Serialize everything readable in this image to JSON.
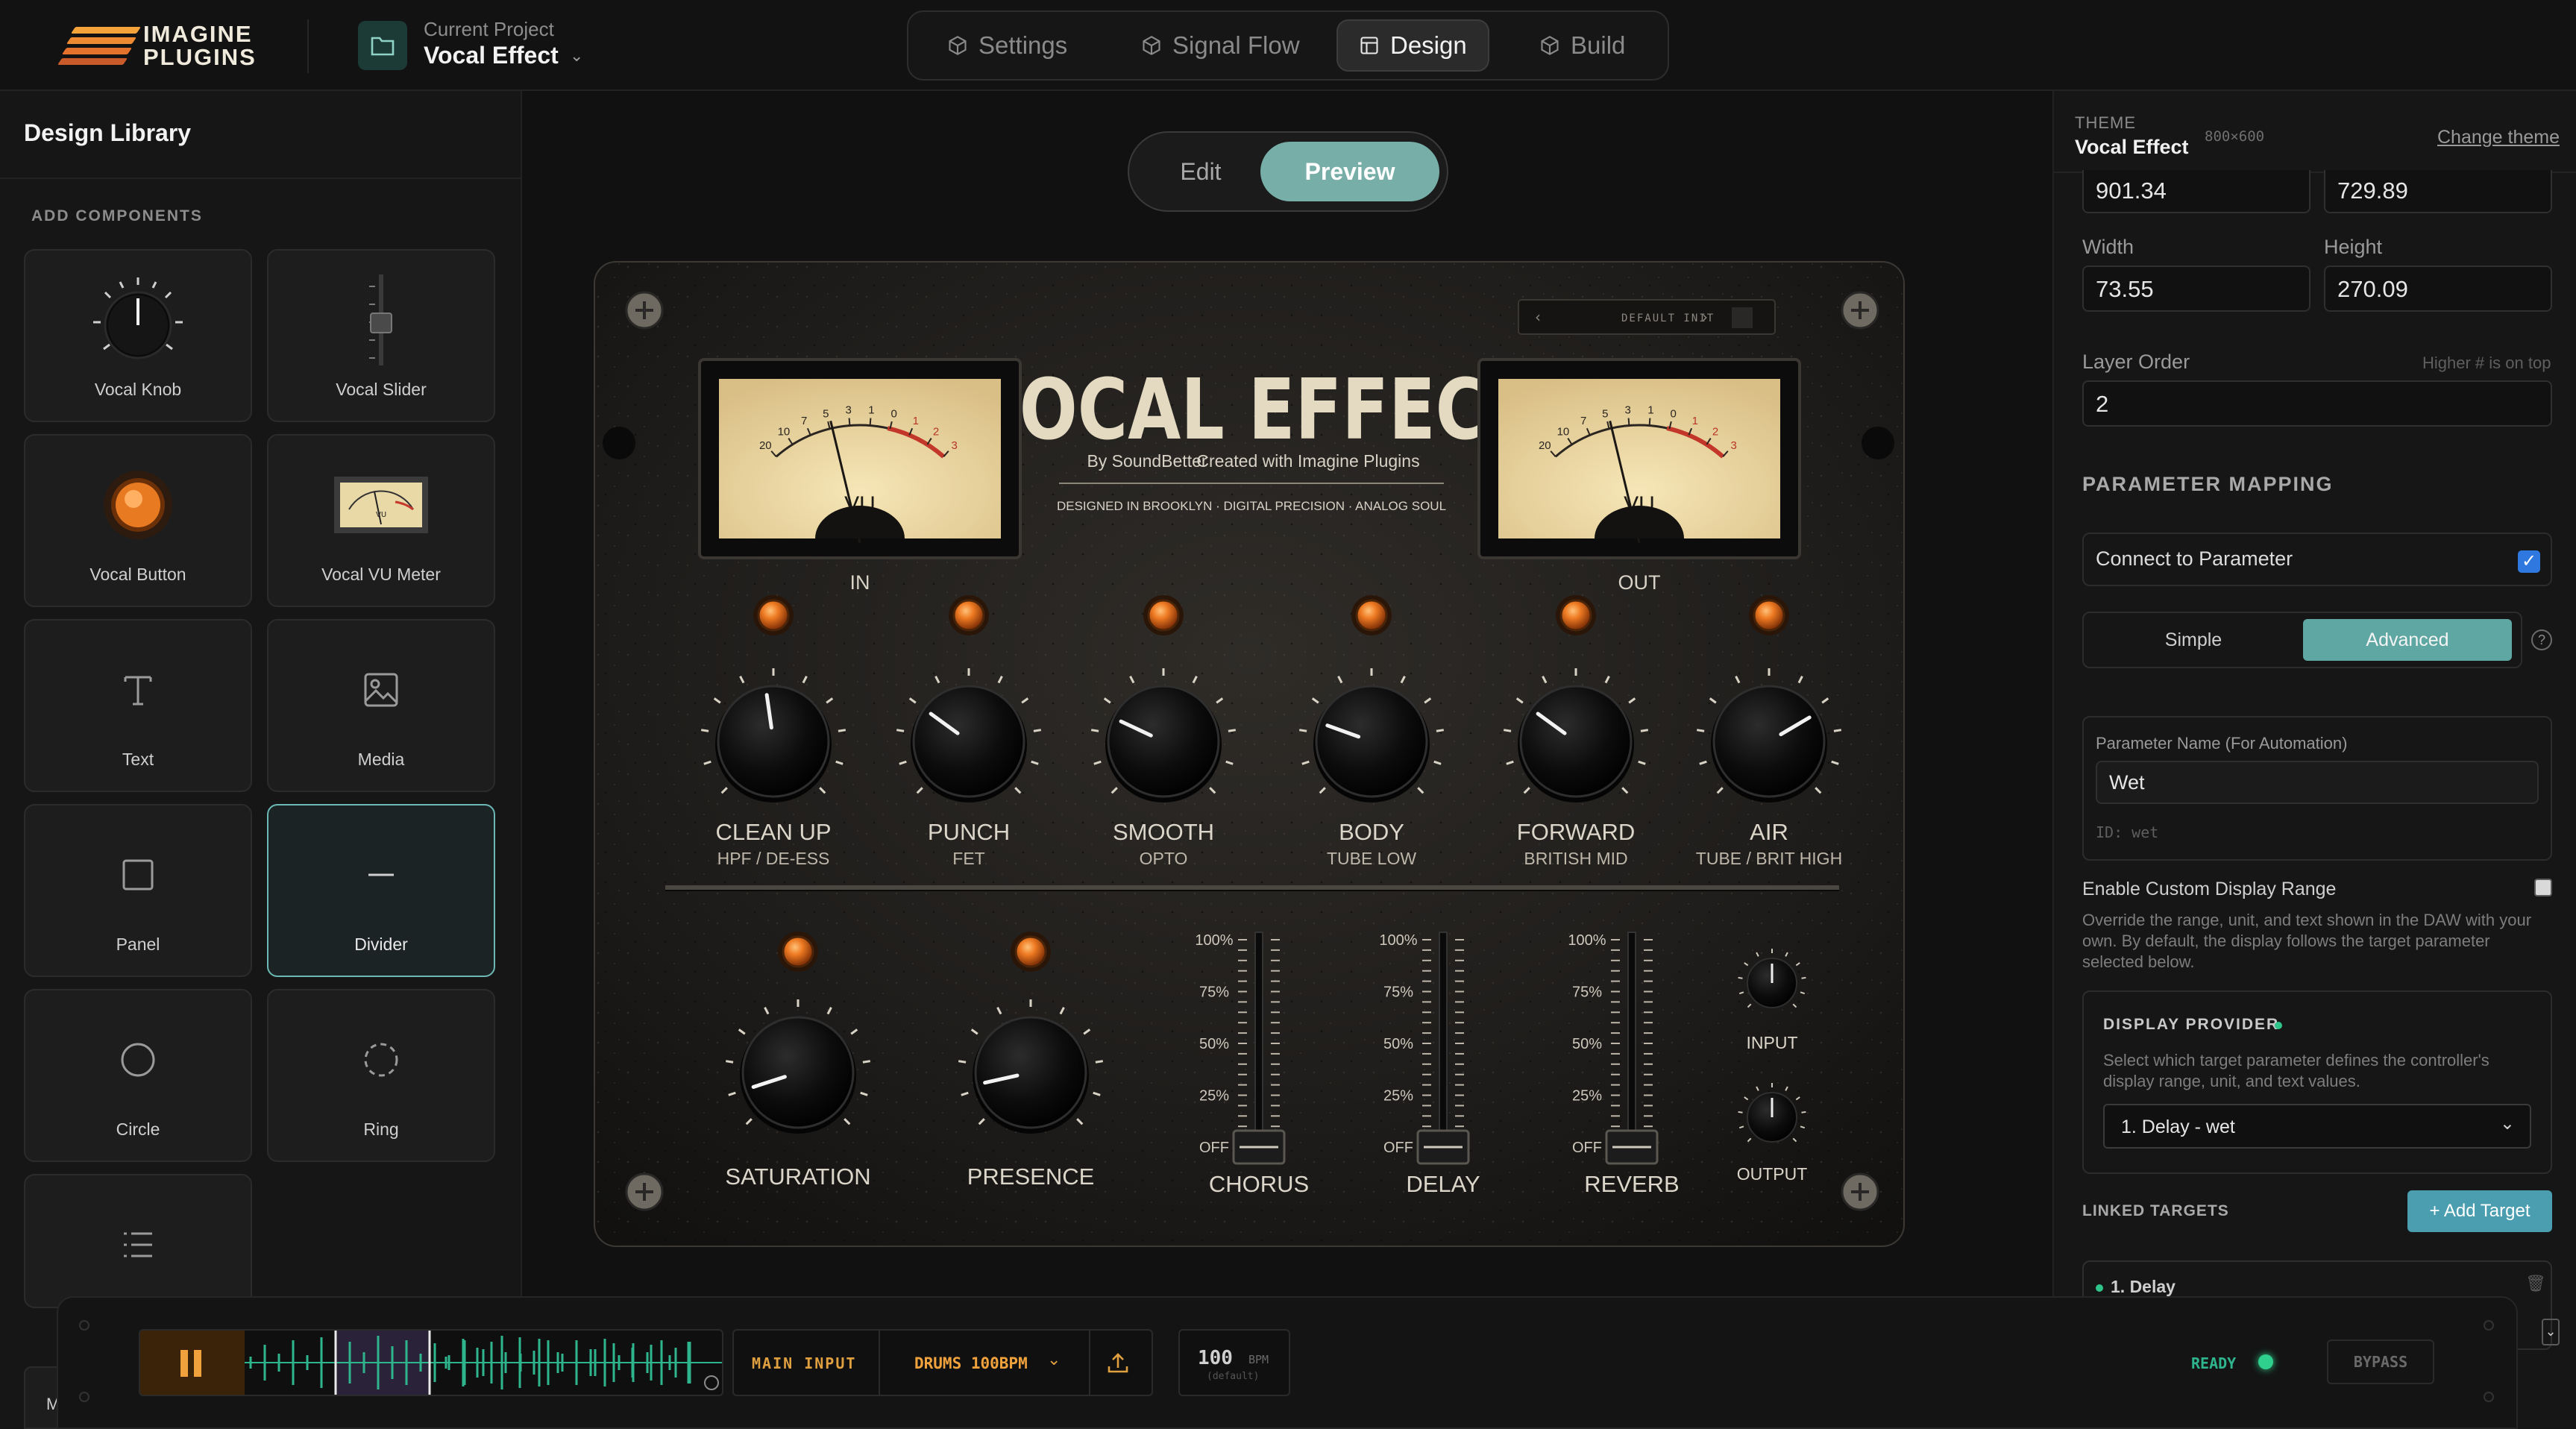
{
  "brand": {
    "name_line1": "IMAGINE",
    "name_line2": "PLUGINS"
  },
  "project": {
    "label": "Current Project",
    "name": "Vocal Effect"
  },
  "nav_tabs": [
    {
      "label": "Settings",
      "icon": "cube-icon",
      "active": false
    },
    {
      "label": "Signal Flow",
      "icon": "cube-icon",
      "active": false
    },
    {
      "label": "Design",
      "icon": "layout-icon",
      "active": true
    },
    {
      "label": "Build",
      "icon": "cube-icon",
      "active": false
    }
  ],
  "library": {
    "title": "Design Library",
    "section": "ADD COMPONENTS",
    "items": [
      {
        "label": "Vocal Knob",
        "icon": "knob-icon"
      },
      {
        "label": "Vocal Slider",
        "icon": "slider-icon"
      },
      {
        "label": "Vocal Button",
        "icon": "orange-button-icon"
      },
      {
        "label": "Vocal VU Meter",
        "icon": "vu-meter-icon"
      },
      {
        "label": "Text",
        "icon": "text-icon"
      },
      {
        "label": "Media",
        "icon": "image-icon"
      },
      {
        "label": "Panel",
        "icon": "square-icon"
      },
      {
        "label": "Divider",
        "icon": "divider-icon"
      },
      {
        "label": "Circle",
        "icon": "circle-icon"
      },
      {
        "label": "Ring",
        "icon": "dashed-circle-icon"
      },
      {
        "label": "",
        "icon": "list-icon"
      }
    ],
    "truncated_item": "M"
  },
  "mode_toggle": {
    "edit": "Edit",
    "preview": "Preview",
    "active": "Preview"
  },
  "plugin": {
    "title": "VOCAL EFFECT",
    "byline": "By SoundBetter",
    "created": "Created with Imagine Plugins",
    "tagline": "DESIGNED IN BROOKLYN · DIGITAL PRECISION · ANALOG SOUL",
    "preset": "DEFAULT INIT",
    "meters": [
      {
        "label": "IN",
        "scale": [
          "20",
          "10",
          "7",
          "5",
          "3",
          "1",
          "0",
          "1",
          "2",
          "3"
        ],
        "unit": "VU"
      },
      {
        "label": "OUT",
        "scale": [
          "20",
          "10",
          "7",
          "5",
          "3",
          "1",
          "0",
          "1",
          "2",
          "3"
        ],
        "unit": "VU"
      }
    ],
    "knobs_top": [
      {
        "name": "CLEAN UP",
        "sub": "HPF / DE-ESS",
        "value": 0.47
      },
      {
        "name": "PUNCH",
        "sub": "FET",
        "value": 0.3
      },
      {
        "name": "SMOOTH",
        "sub": "OPTO",
        "value": 0.26
      },
      {
        "name": "BODY",
        "sub": "TUBE LOW",
        "value": 0.24
      },
      {
        "name": "FORWARD",
        "sub": "BRITISH MID",
        "value": 0.3
      },
      {
        "name": "AIR",
        "sub": "TUBE / BRIT HIGH",
        "value": 0.72
      }
    ],
    "knobs_bottom": [
      {
        "name": "SATURATION",
        "value": 0.1
      },
      {
        "name": "PRESENCE",
        "value": 0.12
      }
    ],
    "faders": [
      {
        "name": "CHORUS",
        "value": 0.0
      },
      {
        "name": "DELAY",
        "value": 0.0
      },
      {
        "name": "REVERB",
        "value": 0.0
      }
    ],
    "fader_scale": [
      "100%",
      "75%",
      "50%",
      "25%",
      "OFF"
    ],
    "small_knobs": [
      {
        "name": "INPUT",
        "value": 0.5
      },
      {
        "name": "OUTPUT",
        "value": 0.5
      }
    ]
  },
  "inspector": {
    "theme_label": "THEME",
    "theme_name": "Vocal Effect",
    "theme_size": "800×600",
    "change_theme": "Change theme",
    "x_value": "901.34",
    "y_value": "729.89",
    "width_label": "Width",
    "width_value": "73.55",
    "height_label": "Height",
    "height_value": "270.09",
    "layer_label": "Layer Order",
    "layer_hint": "Higher # is on top",
    "layer_value": "2",
    "param_section": "PARAMETER MAPPING",
    "connect_label": "Connect to Parameter",
    "connect_checked": true,
    "mode_simple": "Simple",
    "mode_advanced": "Advanced",
    "param_name_label": "Parameter Name (For Automation)",
    "param_name_value": "Wet",
    "param_id": "ID: wet",
    "custom_range_label": "Enable Custom Display Range",
    "custom_range_desc": "Override the range, unit, and text shown in the DAW with your own. By default, the display follows the target parameter selected below.",
    "provider_label": "DISPLAY PROVIDER",
    "provider_desc": "Select which target parameter defines the controller's display range, unit, and text values.",
    "provider_value": "1. Delay - wet",
    "linked_label": "LINKED TARGETS",
    "add_target": "+ Add Target",
    "linked_item": "1. Delay"
  },
  "transport": {
    "input_label": "MAIN INPUT",
    "source": "DRUMS 100BPM",
    "bpm": "100",
    "bpm_unit": "BPM",
    "bpm_note": "(default)",
    "status": "READY",
    "bypass": "BYPASS"
  },
  "colors": {
    "accent_teal": "#78aea8",
    "orange": "#e8741c",
    "bg": "#111111",
    "waveform": "#2fb58e"
  }
}
